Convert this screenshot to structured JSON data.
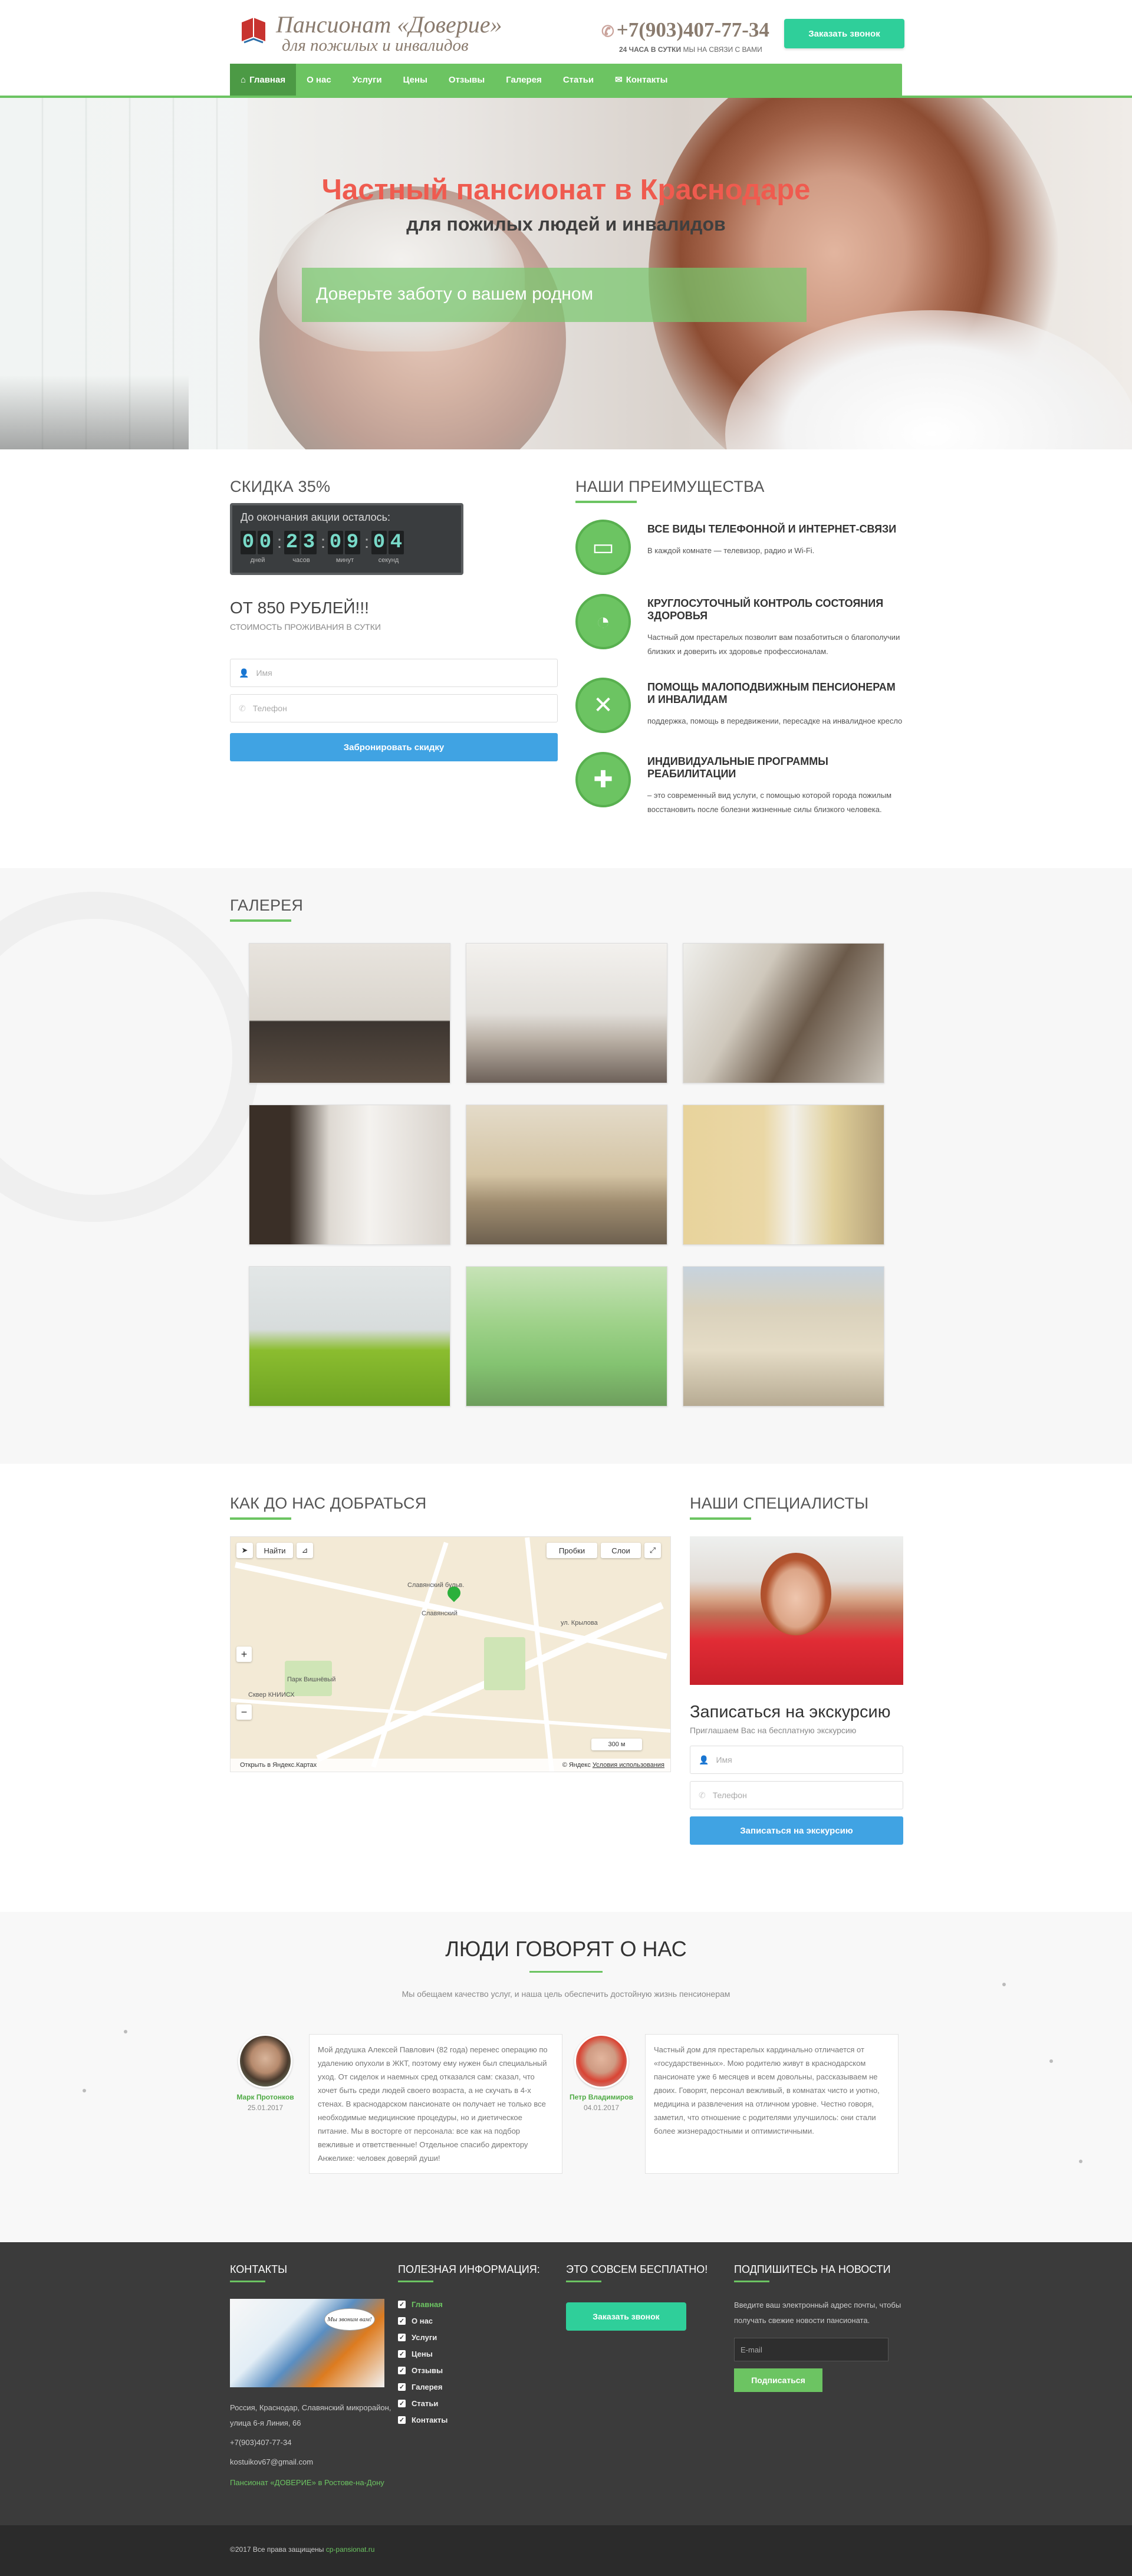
{
  "header": {
    "logo_name": "Пансионат «Доверие»",
    "logo_sub": "для пожилых и инвалидов",
    "phone": "+7(903)407-77-34",
    "phone_note_bold": "24 ЧАСА В СУТКИ",
    "phone_note_rest": "МЫ НА СВЯЗИ С ВАМИ",
    "callback_button": "Заказать звонок"
  },
  "menu": [
    {
      "label": "Главная",
      "icon": "home-icon",
      "active": true
    },
    {
      "label": "О нас"
    },
    {
      "label": "Услуги"
    },
    {
      "label": "Цены"
    },
    {
      "label": "Отзывы"
    },
    {
      "label": "Галерея"
    },
    {
      "label": "Статьи"
    },
    {
      "label": "Контакты",
      "icon": "mail-icon"
    }
  ],
  "hero": {
    "title": "Частный пансионат в Краснодаре",
    "subtitle": "для пожилых людей и инвалидов",
    "box_text": "Доверьте заботу о вашем родном"
  },
  "offer": {
    "discount_heading": "Скидка 35%",
    "timer_title": "До окончания акции осталось:",
    "timer": {
      "days": [
        "0",
        "0"
      ],
      "hours": [
        "2",
        "3"
      ],
      "minutes": [
        "0",
        "9"
      ],
      "seconds": [
        "0",
        "4"
      ],
      "labels": {
        "days": "дней",
        "hours": "часов",
        "minutes": "минут",
        "seconds": "секунд"
      }
    },
    "price": "ОТ 850 РУБЛЕЙ!!!",
    "price_note": "СТОИМОСТЬ ПРОЖИВАНИЯ В СУТКИ",
    "name_placeholder": "Имя",
    "phone_placeholder": "Телефон",
    "submit": "Забронировать скидку"
  },
  "advantages": {
    "heading": "Наши преимущества",
    "items": [
      {
        "icon": "tv-icon",
        "title": "ВСЕ ВИДЫ ТЕЛЕФОННОЙ И ИНТЕРНЕТ-СВЯЗИ",
        "desc": "В каждой комнате — телевизор, радио и Wi-Fi."
      },
      {
        "icon": "clock-24-icon",
        "title": "КРУГЛОСУТОЧНЫЙ КОНТРОЛЬ СОСТОЯНИЯ ЗДОРОВЬЯ",
        "desc": "Частный дом престарелых позволит вам позаботиться о благополучии близких и доверить их здоровье профессионалам."
      },
      {
        "icon": "crutches-icon",
        "title": "ПОМОЩЬ МАЛОПОДВИЖНЫМ ПЕНСИОНЕРАМ И ИНВАЛИДАМ",
        "desc": "поддержка, помощь в передвижении, пересадке на инвалидное кресло"
      },
      {
        "icon": "clipboard-icon",
        "title": "ИНДИВИДУАЛЬНЫЕ ПРОГРАММЫ РЕАБИЛИТАЦИИ",
        "desc": "– это современный вид услуги, с помощью которой города пожилым восстановить после болезни жизненные силы близкого человека."
      }
    ]
  },
  "gallery": {
    "heading": "Галерея"
  },
  "map": {
    "heading": "Как до нас добраться",
    "find": "Найти",
    "traffic": "Пробки",
    "layers": "Слои",
    "open_link": "Открыть в Яндекс.Картах",
    "copyright": "© Яндекс",
    "terms": "Условия использования",
    "scale": "300 м",
    "labels": [
      "Славянский бульв.",
      "Славянский",
      "ул. Крылова",
      "Парк Вишнёвый",
      "Сквер КНИИСХ"
    ]
  },
  "specialists": {
    "heading": "Наши специалисты",
    "title": "Записаться на экскурсию",
    "subtitle": "Приглашаем Вас на бесплатную экскурсию",
    "name_placeholder": "Имя",
    "phone_placeholder": "Телефон",
    "submit": "Записаться на экскурсию"
  },
  "testimonials": {
    "title": "Люди говорят о нас",
    "subtitle": "Мы обещаем качество услуг, и наша цель обеспечить достойную жизнь пенсионерам",
    "items": [
      {
        "name": "Марк Протонков",
        "date": "25.01.2017",
        "text": "Мой дедушка Алексей Павлович (82 года) перенес операцию по удалению опухоли в ЖКТ, поэтому ему нужен был специальный уход. От сиделок и наемных сред отказался сам: сказал, что хочет быть среди людей своего возраста, а не скучать в 4-х стенах. В краснодарском пансионате он получает не только все необходимые медицинские процедуры, но и диетическое питание. Мы в восторге от персонала: все как на подбор вежливые и ответственные! Отдельное спасибо директору Анжелике: человек доверяй души!"
      },
      {
        "name": "Петр Владимиров",
        "date": "04.01.2017",
        "text": "Частный дом для престарелых кардинально отличается от «государственных». Мою родителю живут в краснодарском пансионате уже 6 месяцев и всем довольны, рассказываем не двоих. Говорят, персонал вежливый, в комнатах чисто и уютно, медицина и развлечения на отличном уровне. Честно говоря, заметил, что отношение с родителями улучшилось: они стали более жизнерадостными и оптимистичными."
      }
    ]
  },
  "footer": {
    "contacts_heading": "Контакты",
    "image_bubble": "Мы звоним вам!",
    "address": "Россия, Краснодар, Славянский микрорайон, улица 6-я Линия, 66",
    "phone": "+7(903)407-77-34",
    "email": "kostuikov67@gmail.com",
    "link": "Пансионат «ДОВЕРИЕ» в Ростове-на-Дону",
    "useful_heading": "Полезная информация:",
    "useful_items": [
      "Главная",
      "О нас",
      "Услуги",
      "Цены",
      "Отзывы",
      "Галерея",
      "Статьи",
      "Контакты"
    ],
    "free_heading": "Это совсем бесплатно!",
    "free_button": "Заказать звонок",
    "news_heading": "Подпишитесь на новости",
    "news_text": "Введите ваш электронный адрес почты, чтобы получать свежие новости пансионата.",
    "email_placeholder": "E-mail",
    "subscribe": "Подписаться"
  },
  "bottom": {
    "copyright": "©2017 Все права защищены",
    "site": "cp-pansionat.ru"
  },
  "colors": {
    "green": "#6cc462",
    "teal": "#2fcf9a",
    "blue": "#40a3e3",
    "red_title": "#ef5b4f",
    "footer_bg": "#3b3b3b"
  }
}
